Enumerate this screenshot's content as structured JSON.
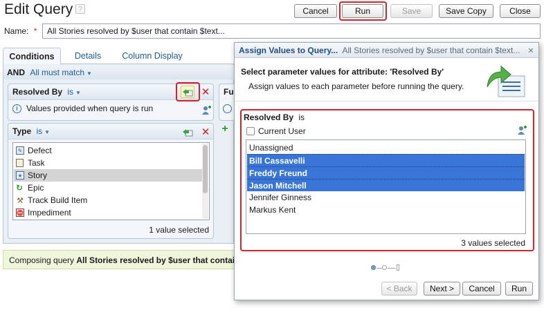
{
  "header": {
    "title": "Edit Query",
    "help_icon": "question-icon",
    "buttons": {
      "cancel": "Cancel",
      "run": "Run",
      "save": "Save",
      "save_copy": "Save Copy",
      "close": "Close"
    }
  },
  "name_field": {
    "label": "Name:",
    "required_marker": "*",
    "value": "All Stories resolved by $user that contain $text..."
  },
  "tabs": [
    {
      "label": "Conditions",
      "active": true
    },
    {
      "label": "Details",
      "active": false
    },
    {
      "label": "Column Display",
      "active": false
    }
  ],
  "conditions": {
    "group_op": "AND",
    "group_mode": "All must match",
    "resolved_by": {
      "attribute": "Resolved By",
      "operator": "is",
      "note": "Values provided when query is run"
    },
    "type": {
      "attribute": "Type",
      "operator": "is",
      "items": [
        {
          "label": "Defect",
          "icon": "defect-icon"
        },
        {
          "label": "Task",
          "icon": "task-icon"
        },
        {
          "label": "Story",
          "icon": "story-icon",
          "selected": true
        },
        {
          "label": "Epic",
          "icon": "epic-icon"
        },
        {
          "label": "Track Build Item",
          "icon": "track-build-item-icon"
        },
        {
          "label": "Impediment",
          "icon": "impediment-icon"
        }
      ],
      "selected_count": "1 value selected"
    },
    "clipped_panel_title": "Fu"
  },
  "status_bar": {
    "prefix": "Composing query ",
    "query_name": "All Stories resolved by $user that contai"
  },
  "dialog": {
    "title": "Assign Values to Query...",
    "subtitle": "All Stories resolved by $user that contain $text...",
    "heading": "Select parameter values for attribute: 'Resolved By'",
    "description": "Assign values to each parameter before running the query.",
    "attribute": "Resolved By",
    "operator": "is",
    "current_user_label": "Current User",
    "current_user_checked": false,
    "values": [
      {
        "label": "Unassigned",
        "selected": false
      },
      {
        "label": "Bill Cassavelli",
        "selected": true
      },
      {
        "label": "Freddy Freund",
        "selected": true
      },
      {
        "label": "Jason Mitchell",
        "selected": true
      },
      {
        "label": "Jennifer Ginness",
        "selected": false
      },
      {
        "label": "Markus Kent",
        "selected": false
      }
    ],
    "selected_count": "3 values selected",
    "buttons": {
      "back": "< Back",
      "next": "Next >",
      "cancel": "Cancel",
      "run": "Run"
    }
  },
  "colors": {
    "selection": "#3875d7",
    "highlight": "#d6202a",
    "link": "#1f5c99",
    "status_bg": "#eef6dc"
  }
}
